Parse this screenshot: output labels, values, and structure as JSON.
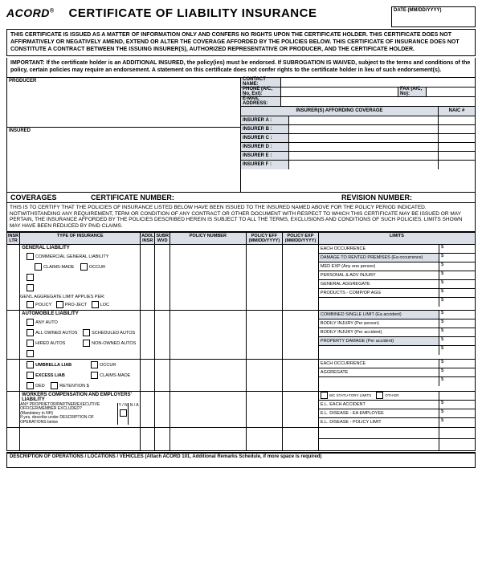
{
  "logo": "ACORD",
  "title": "CERTIFICATE OF LIABILITY INSURANCE",
  "date_label": "DATE (MM/DD/YYYY)",
  "notice1": "THIS CERTIFICATE IS ISSUED AS A MATTER OF INFORMATION ONLY AND CONFERS NO RIGHTS UPON THE CERTIFICATE HOLDER. THIS CERTIFICATE DOES NOT AFFIRMATIVELY OR NEGATIVELY AMEND, EXTEND OR ALTER THE COVERAGE AFFORDED BY THE POLICIES BELOW. THIS CERTIFICATE OF INSURANCE DOES NOT CONSTITUTE A CONTRACT BETWEEN THE ISSUING INSURER(S), AUTHORIZED REPRESENTATIVE OR PRODUCER, AND THE CERTIFICATE HOLDER.",
  "notice2": "IMPORTANT: If the certificate holder is an ADDITIONAL INSURED, the policy(ies) must be endorsed. If SUBROGATION IS WAIVED, subject to the terms and conditions of the policy, certain policies may require an endorsement. A statement on this certificate does not confer rights to the certificate holder in lieu of such endorsement(s).",
  "producer": "PRODUCER",
  "insured": "INSURED",
  "contact": {
    "name": "CONTACT NAME:",
    "phone": "PHONE (A/C, No, Ext):",
    "fax": "FAX (A/C, No):",
    "email": "E-MAIL ADDRESS:",
    "naic": "NAIC #",
    "afford": "INSURER(S) AFFORDING COVERAGE",
    "ins_a": "INSURER A :",
    "ins_b": "INSURER B :",
    "ins_c": "INSURER C :",
    "ins_d": "INSURER D :",
    "ins_e": "INSURER E :",
    "ins_f": "INSURER F :"
  },
  "cov": {
    "h1": "COVERAGES",
    "h2": "CERTIFICATE NUMBER:",
    "h3": "REVISION NUMBER:",
    "text": "THIS IS TO CERTIFY THAT THE POLICIES OF INSURANCE LISTED BELOW HAVE BEEN ISSUED TO THE INSURED NAMED ABOVE FOR THE POLICY PERIOD INDICATED. NOTWITHSTANDING ANY REQUIREMENT, TERM OR CONDITION OF ANY CONTRACT OR OTHER DOCUMENT WITH RESPECT TO WHICH THIS CERTIFICATE MAY BE ISSUED OR MAY PERTAIN, THE INSURANCE AFFORDED BY THE POLICIES DESCRIBED HEREIN IS SUBJECT TO ALL THE TERMS, EXCLUSIONS AND CONDITIONS OF SUCH POLICIES. LIMITS SHOWN MAY HAVE BEEN REDUCED BY PAID CLAIMS."
  },
  "cols": {
    "ltr": "INSR LTR",
    "type": "TYPE OF INSURANCE",
    "addl": "ADDL INSR",
    "subr": "SUBR WVD",
    "policy": "POLICY NUMBER",
    "eff": "POLICY EFF (MM/DD/YYYY)",
    "exp": "POLICY EXP (MM/DD/YYYY)",
    "limits": "LIMITS"
  },
  "gl": {
    "head": "GENERAL LIABILITY",
    "comm": "COMMERCIAL GENERAL LIABILITY",
    "claims": "CLAIMS-MADE",
    "occur": "OCCUR",
    "agg": "GEN'L AGGREGATE LIMIT APPLIES PER:",
    "policy": "POLICY",
    "project": "PRO-JECT",
    "loc": "LOC",
    "l1": "EACH OCCURRENCE",
    "l2": "DAMAGE TO RENTED PREMISES (Ea occurrence)",
    "l3": "MED EXP (Any one person)",
    "l4": "PERSONAL & ADV INJURY",
    "l5": "GENERAL AGGREGATE",
    "l6": "PRODUCTS - COMP/OP AGG"
  },
  "auto": {
    "head": "AUTOMOBILE LIABILITY",
    "any": "ANY AUTO",
    "all": "ALL OWNED AUTOS",
    "sched": "SCHEDULED AUTOS",
    "hired": "HIRED AUTOS",
    "non": "NON-OWNED AUTOS",
    "l1": "COMBINED SINGLE LIMIT (Ea accident)",
    "l2": "BODILY INJURY (Per person)",
    "l3": "BODILY INJURY (Per accident)",
    "l4": "PROPERTY DAMAGE (Per accident)"
  },
  "umb": {
    "umb": "UMBRELLA LIAB",
    "exc": "EXCESS LIAB",
    "occur": "OCCUR",
    "claims": "CLAIMS-MADE",
    "ded": "DED",
    "ret": "RETENTION $",
    "l1": "EACH OCCURRENCE",
    "l2": "AGGREGATE"
  },
  "wc": {
    "head": "WORKERS COMPENSATION AND EMPLOYERS' LIABILITY",
    "prop": "ANY PROPRIETOR/PARTNER/EXECUTIVE OFFICER/MEMBER EXCLUDED?",
    "mand": "(Mandatory in NH)",
    "desc": "If yes, describe under DESCRIPTION OF OPERATIONS below",
    "yn": "Y / N",
    "na": "N / A",
    "stat": "WC STATU-TORY LIMITS",
    "oth": "OTH-ER",
    "l1": "E.L. EACH ACCIDENT",
    "l2": "E.L. DISEASE - EA EMPLOYEE",
    "l3": "E.L. DISEASE - POLICY LIMIT"
  },
  "dollar": "$",
  "desc_ops": "DESCRIPTION OF OPERATIONS / LOCATIONS / VEHICLES (Attach ACORD 101, Additional Remarks Schedule, if more space is required)"
}
